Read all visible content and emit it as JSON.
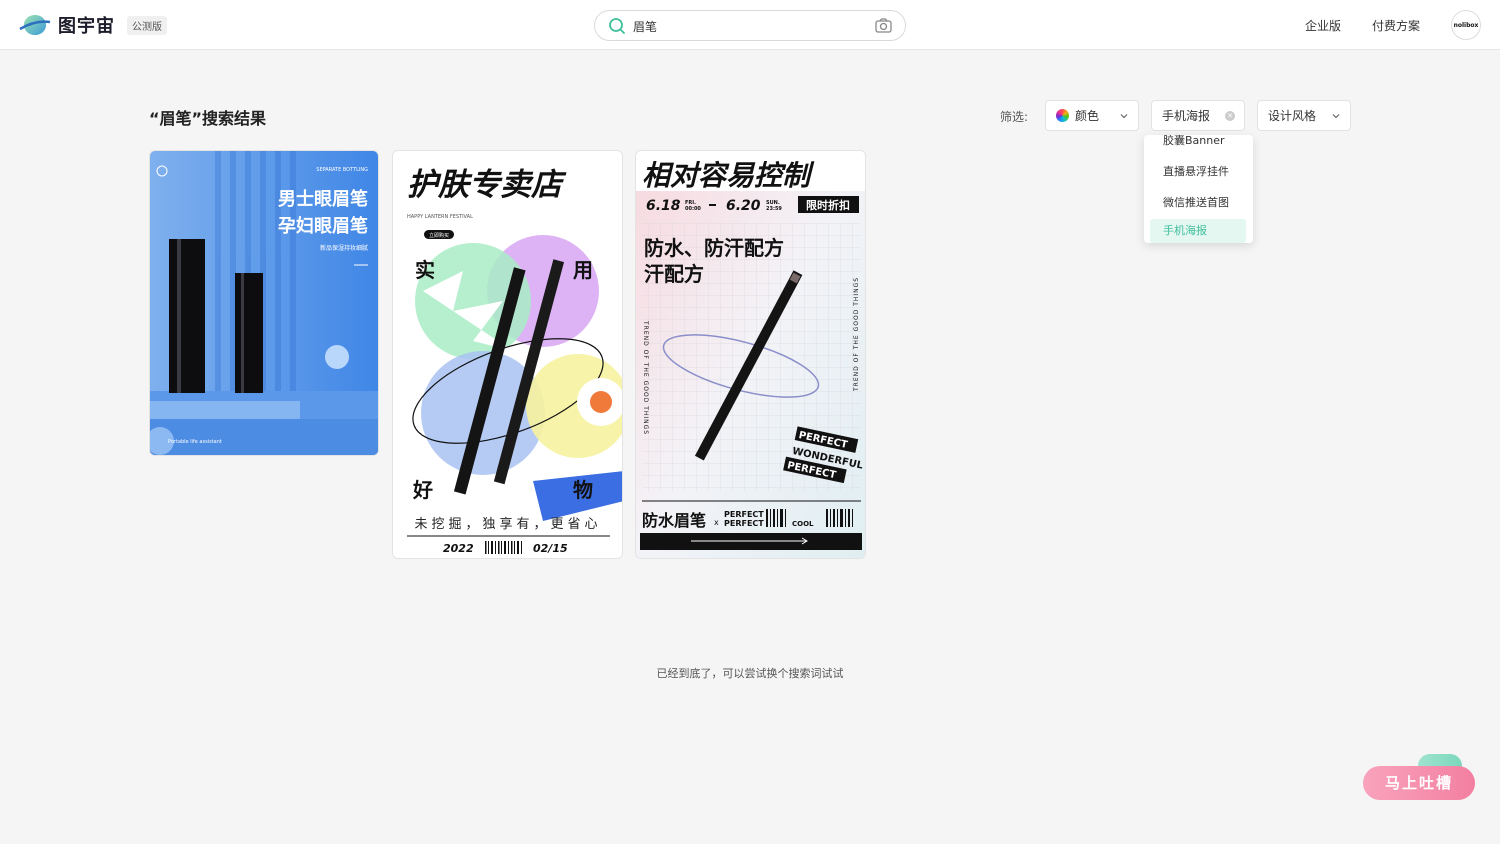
{
  "header": {
    "logo_text": "图宇宙",
    "beta_badge": "公测版",
    "search_value": "眉笔",
    "nav": [
      "企业版",
      "付费方案"
    ],
    "avatar_text": "nolibox"
  },
  "results": {
    "title": "“眉笔”搜索结果",
    "filter_label": "筛选:",
    "filters": {
      "color": "颜色",
      "type": "手机海报",
      "style": "设计风格"
    },
    "dropdown_items": [
      "胶囊Banner",
      "直播悬浮挂件",
      "微信推送首图",
      "手机海报"
    ],
    "selected_item": "手机海报"
  },
  "cards": [
    {
      "top_tag": "SEPARATE BOTTLING",
      "headline_1": "男士眼眉笔",
      "headline_2": "孕妇眼眉笔",
      "sub": "新品保湿持妆细腻",
      "footer": "Portable life assistant"
    },
    {
      "headline": "护肤专卖店",
      "sub_en": "HAPPY LANTERN FESTIVAL",
      "buy_tag": "立即购买",
      "corner_1": "实",
      "corner_2": "用",
      "corner_3": "好",
      "corner_4": "物",
      "slogan": "未挖掘，独享有，更省心",
      "year": "2022",
      "date": "02/15"
    },
    {
      "headline": "相对容易控制",
      "date_1": "6.18",
      "day_1": "FRI.",
      "time_1": "00:00",
      "date_2": "6.20",
      "day_2": "SUN.",
      "time_2": "23:59",
      "promo": "限时折扣",
      "sub": "防水、防汗配方",
      "side_text": "TREND OF THE GOOD THINGS",
      "stamp_1": "PERFECT",
      "stamp_2": "WONDERFUL",
      "stamp_3": "PERFECT",
      "product": "防水眉笔",
      "x_mark": "x",
      "perfect_1": "PERFECT",
      "perfect_2": "PERFECT",
      "cool": "COOL"
    }
  ],
  "footer_note": "已经到底了，可以尝试换个搜索词试试",
  "feedback_label": "马上吐槽",
  "colors": {
    "accent": "#3fbf9b",
    "feedback": "#f37fa1"
  }
}
